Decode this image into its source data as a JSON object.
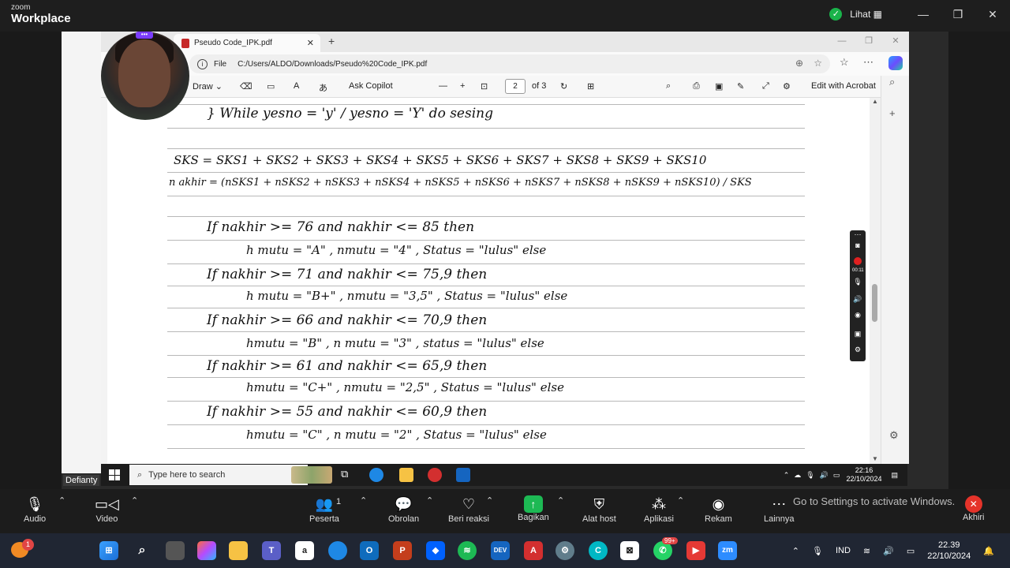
{
  "zoom": {
    "brand_small": "zoom",
    "brand_big": "Workplace",
    "view_label": "Lihat",
    "participant_name": "Defianty",
    "participants_count": "1",
    "controls": [
      "Audio",
      "Video",
      "Peserta",
      "Obrolan",
      "Beri reaksi",
      "Bagikan",
      "Alat host",
      "Aplikasi",
      "Rekam",
      "Lainnya",
      "Akhiri"
    ],
    "watermark": "Go to Settings to activate Windows."
  },
  "browser": {
    "tab_title": "Pseudo Code_IPK.pdf",
    "url_label": "File",
    "url": "C:/Users/ALDO/Downloads/Pseudo%20Code_IPK.pdf"
  },
  "pdf_toolbar": {
    "draw": "Draw",
    "ask_copilot": "Ask Copilot",
    "page_current": "2",
    "page_total": "of 3",
    "edit_acrobat": "Edit with Acrobat"
  },
  "document": {
    "lines": [
      "} While  yesno = 'y'  /  yesno = 'Y'  do sesing",
      "SKS = SKS1 + SKS2 + SKS3 + SKS4 + SKS5 + SKS6 + SKS7 + SKS8 + SKS9 + SKS10",
      "n akhir = (nSKS1 + nSKS2 + nSKS3 + nSKS4 + nSKS5 + nSKS6 + nSKS7 + nSKS8 + nSKS9 + nSKS10) / SKS",
      "If  nakhir >= 76  and  nakhir <= 85  then",
      "h mutu = \"A\" , nmutu = \"4\" , Status = \"lulus\"  else",
      "If  nakhir >= 71  and  nakhir <= 75,9  then",
      "h mutu = \"B+\" , nmutu = \"3,5\" , Status = \"lulus\"  else",
      "If  nakhir >= 66  and  nakhir <= 70,9  then",
      "hmutu = \"B\" , n mutu = \"3\" , status = \"lulus\"  else",
      "If  nakhir >= 61  and  nakhir <= 65,9  then",
      "hmutu = \"C+\" , nmutu = \"2,5\" , Status = \"lulus\"  else",
      "If  nakhir >= 55  and  nakhir <= 60,9  then",
      "hmutu = \"C\" , n mutu = \"2\" , Status = \"lulus\"  else"
    ]
  },
  "inner_taskbar": {
    "search_placeholder": "Type here to search",
    "time": "22:16",
    "date": "22/10/2024"
  },
  "outer_taskbar": {
    "notif_count": "1",
    "whatsapp_badge": "99+",
    "lang": "IND",
    "time": "22.39",
    "date": "22/10/2024"
  },
  "rec_bar": {
    "timer": "00:11"
  }
}
